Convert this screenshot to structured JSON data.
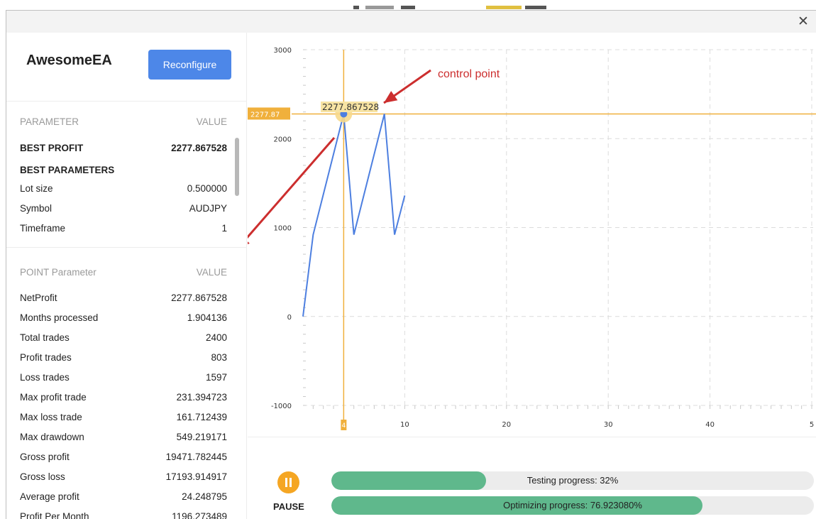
{
  "window": {
    "close_icon": "close-icon",
    "close_glyph": "✕"
  },
  "app": {
    "name": "AwesomeEA",
    "reconfigure_label": "Reconfigure"
  },
  "best_table": {
    "header_param": "PARAMETER",
    "header_value": "VALUE",
    "best_profit_label": "BEST PROFIT",
    "best_profit_value": "2277.867528",
    "best_params_label": "BEST PARAMETERS",
    "rows": [
      {
        "label": "Lot size",
        "value": "0.500000"
      },
      {
        "label": "Symbol",
        "value": "AUDJPY"
      },
      {
        "label": "Timeframe",
        "value": "1"
      }
    ]
  },
  "point_table": {
    "header_param": "POINT Parameter",
    "header_value": "VALUE",
    "rows": [
      {
        "label": "NetProfit",
        "value": "2277.867528"
      },
      {
        "label": "Months processed",
        "value": "1.904136"
      },
      {
        "label": "Total trades",
        "value": "2400"
      },
      {
        "label": "Profit trades",
        "value": "803"
      },
      {
        "label": "Loss trades",
        "value": "1597"
      },
      {
        "label": "Max profit trade",
        "value": "231.394723"
      },
      {
        "label": "Max loss trade",
        "value": "161.712439"
      },
      {
        "label": "Max drawdown",
        "value": "549.219171"
      },
      {
        "label": "Gross profit",
        "value": "19471.782445"
      },
      {
        "label": "Gross loss",
        "value": "17193.914917"
      },
      {
        "label": "Average profit",
        "value": "24.248795"
      },
      {
        "label": "Profit Per Month",
        "value": "1196.273489"
      }
    ]
  },
  "chart_data": {
    "type": "line",
    "x_ticks": [
      "4",
      "10",
      "20",
      "30",
      "40",
      "5"
    ],
    "y_ticks": [
      "3000",
      "2000",
      "1000",
      "0",
      "-1000"
    ],
    "ylim": [
      -1000,
      3000
    ],
    "xlim": [
      0,
      50
    ],
    "grid": true,
    "series": [
      {
        "x": [
          0,
          1,
          4,
          5,
          8,
          9,
          10
        ],
        "y": [
          0,
          920,
          2277.87,
          920,
          2277.87,
          920,
          1360
        ]
      }
    ],
    "control_point": {
      "x": 4,
      "y": 2277.87,
      "label": "2277.867528",
      "y_axis_tag": "2277.87",
      "x_axis_tag": "4"
    },
    "annotation": "control point",
    "line_color": "#4d7fe0",
    "crosshair_color": "#f0b03c",
    "arrow_color": "#cc2e2e"
  },
  "controls": {
    "pause_icon": "pause-icon",
    "pause_label": "PAUSE",
    "testing": {
      "label": "Testing progress: 32%",
      "fraction": 0.32
    },
    "optimizing": {
      "label": "Optimizing progress: 76.923080%",
      "fraction": 0.7692308
    }
  }
}
